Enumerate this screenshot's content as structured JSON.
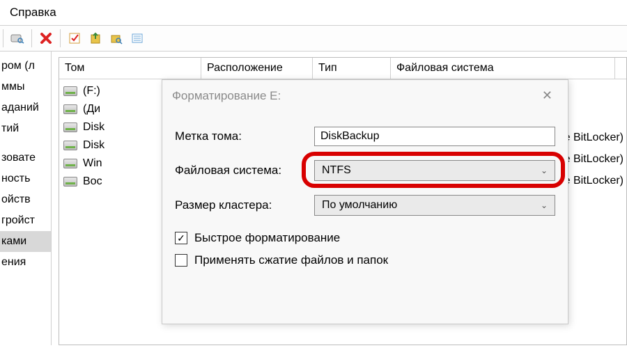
{
  "menu": {
    "help": "Справка"
  },
  "sidebar": {
    "items": [
      "ром (л",
      "ммы",
      "аданий",
      "тий",
      "",
      "зовате",
      "ность",
      "ойств",
      "гройст",
      "ками",
      "ения"
    ],
    "selected_index": 9
  },
  "grid": {
    "headers": [
      "Том",
      "Расположение",
      "Тип",
      "Файловая система"
    ],
    "rows": [
      {
        "volume": "(F:)"
      },
      {
        "volume": "(Ди"
      },
      {
        "volume": "Disk"
      },
      {
        "volume": "Disk"
      },
      {
        "volume": "Win"
      },
      {
        "volume": "Вос"
      }
    ],
    "right_tails": [
      "ание BitLocker)",
      "ание BitLocker)",
      "ание BitLocker)"
    ]
  },
  "dialog": {
    "title": "Форматирование E:",
    "labels": {
      "volume": "Метка тома:",
      "filesystem": "Файловая система:",
      "cluster": "Размер кластера:"
    },
    "values": {
      "volume": "DiskBackup",
      "filesystem": "NTFS",
      "cluster": "По умолчанию"
    },
    "checkboxes": {
      "quick": {
        "label": "Быстрое форматирование",
        "checked": true
      },
      "compress": {
        "label": "Применять сжатие файлов и папок",
        "checked": false
      }
    }
  }
}
